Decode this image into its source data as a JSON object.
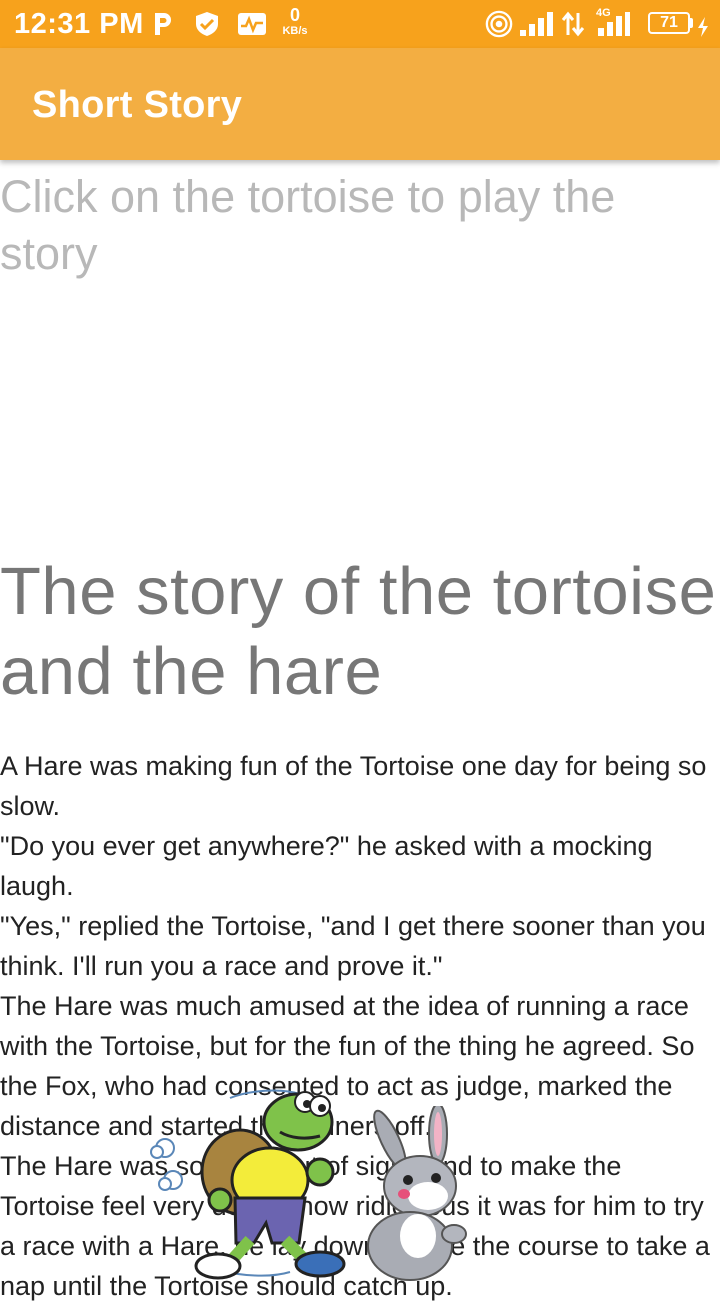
{
  "status_bar": {
    "time": "12:31 PM",
    "net_speed_value": "0",
    "net_speed_unit": "KB/s",
    "network_type": "4G",
    "battery_level": "71",
    "icons": [
      "p-app-icon",
      "shield-icon",
      "activity-monitor-icon",
      "hotspot-icon",
      "signal-icon",
      "data-arrows-icon",
      "signal-4g-icon",
      "battery-icon",
      "charging-icon"
    ]
  },
  "app_bar": {
    "title": "Short Story",
    "color": "#f3ae42"
  },
  "main": {
    "instruction": "Click on the tortoise to play the story",
    "heading": "The story of the tortoise and the hare",
    "body": "A Hare was making fun of the Tortoise one day for being so slow.\n \"Do you ever get anywhere?\" he asked with a mocking laugh.\n \"Yes,\" replied the Tortoise, \"and I get there sooner than you think. I'll run you a race and prove it.\"\n The Hare was much amused at the idea of running a race with the Tortoise, but for the fun of the thing he agreed. So the Fox, who had consented to act as judge, marked the distance and started the runners off.\n The Hare was soon far out of sight, and to make the Tortoise feel very deeply how ridiculous it was for him to try a race with a Hare, he lay down beside the course to take a nap until the Tortoise should catch up."
  },
  "colors": {
    "status_bar": "#f7a21c",
    "accent": "#f3ae42"
  }
}
